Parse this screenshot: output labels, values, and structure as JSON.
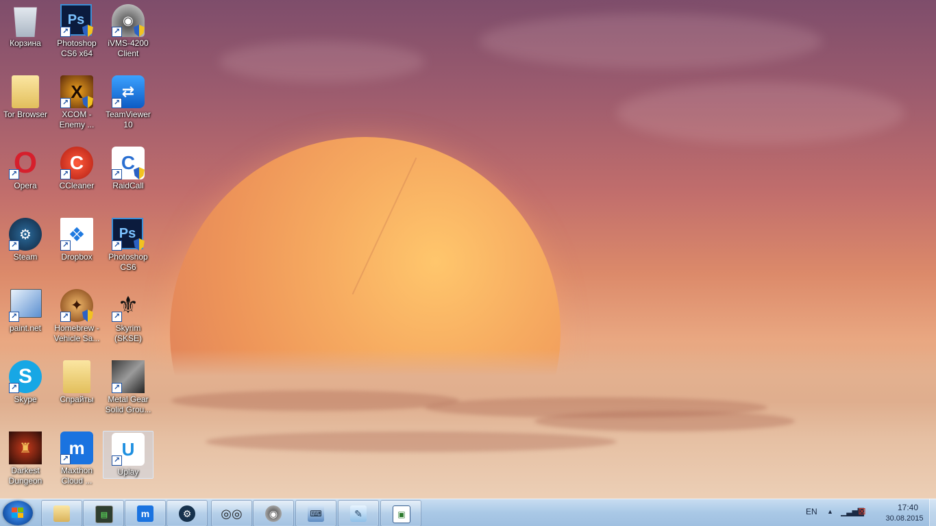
{
  "desktop": {
    "icons": [
      {
        "label": "Корзина",
        "icon": "recycle-bin-icon"
      },
      {
        "label": "Photoshop CS6 x64",
        "icon": "photoshop-icon"
      },
      {
        "label": "iVMS-4200 Client",
        "icon": "camera-icon"
      },
      {
        "label": "Tor Browser",
        "icon": "folder-icon"
      },
      {
        "label": "XCOM - Enemy ...",
        "icon": "xcom-icon"
      },
      {
        "label": "TeamViewer 10",
        "icon": "teamviewer-icon"
      },
      {
        "label": "Opera",
        "icon": "opera-icon"
      },
      {
        "label": "CCleaner",
        "icon": "ccleaner-icon"
      },
      {
        "label": "RaidCall",
        "icon": "raidcall-icon"
      },
      {
        "label": "Steam",
        "icon": "steam-icon"
      },
      {
        "label": "Dropbox",
        "icon": "dropbox-icon"
      },
      {
        "label": "Photoshop CS6",
        "icon": "photoshop-icon"
      },
      {
        "label": "paint.net",
        "icon": "paintnet-icon"
      },
      {
        "label": "Homebrew - Vehicle Sa...",
        "icon": "homebrew-icon"
      },
      {
        "label": "Skyrim (SKSE)",
        "icon": "skyrim-icon"
      },
      {
        "label": "Skype",
        "icon": "skype-icon"
      },
      {
        "label": "Спрайты",
        "icon": "folder-icon"
      },
      {
        "label": "Metal Gear Solid Grou...",
        "icon": "metal-gear-icon"
      },
      {
        "label": "Darkest Dungeon",
        "icon": "darkest-dungeon-icon"
      },
      {
        "label": "Maxthon Cloud ...",
        "icon": "maxthon-icon"
      },
      {
        "label": "Uplay",
        "icon": "uplay-icon"
      }
    ]
  },
  "taskbar": {
    "pinned": [
      {
        "name": "explorer",
        "icon": "folder-icon"
      },
      {
        "name": "task-manager",
        "icon": "monitor-icon"
      },
      {
        "name": "maxthon",
        "icon": "maxthon-icon"
      },
      {
        "name": "steam",
        "icon": "steam-icon"
      },
      {
        "name": "spy-app",
        "icon": "binoculars-icon"
      },
      {
        "name": "ivms",
        "icon": "camera-icon"
      },
      {
        "name": "computer",
        "icon": "keyboard-icon"
      },
      {
        "name": "notepad",
        "icon": "notepad-icon"
      },
      {
        "name": "window",
        "icon": "window-icon"
      }
    ],
    "tray": {
      "language": "EN",
      "time": "17:40",
      "date": "30.08.2015"
    }
  }
}
